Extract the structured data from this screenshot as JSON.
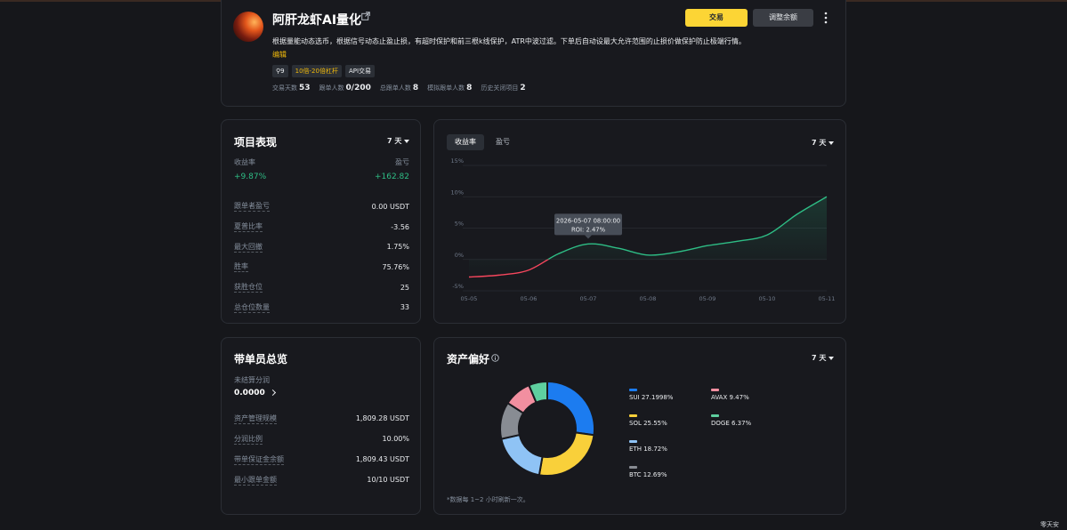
{
  "header": {
    "trader_name": "阿肝龙虾AI量化",
    "description": "根据量能动态选币，根据信号动态止盈止损，有超时保护和前三根k线保护，ATR中波过滤。下单后自动设最大允许范围的止损价做保护防止极端行情。",
    "edit_label": "编辑",
    "tags": [
      "9",
      "10倍-20倍杠杆",
      "API交易"
    ],
    "stats": [
      {
        "label": "交易天数",
        "value": "53"
      },
      {
        "label": "跟单人数",
        "value": "0/200"
      },
      {
        "label": "总跟单人数",
        "value": "8"
      },
      {
        "label": "模拟跟单人数",
        "value": "8"
      },
      {
        "label": "历史关闭项目",
        "value": "2"
      }
    ],
    "trade_button": "交易",
    "adjust_button": "调整余额"
  },
  "performance": {
    "title": "项目表现",
    "period": "7 天",
    "roi_label": "收益率",
    "pnl_label": "盈亏",
    "roi_value": "+9.87%",
    "pnl_value": "+162.82",
    "metrics": [
      {
        "label": "跟单者盈亏",
        "value": "0.00 USDT"
      },
      {
        "label": "夏普比率",
        "value": "-3.56"
      },
      {
        "label": "最大回撤",
        "value": "1.75%"
      },
      {
        "label": "胜率",
        "value": "75.76%"
      },
      {
        "label": "获胜仓位",
        "value": "25"
      },
      {
        "label": "总仓位数量",
        "value": "33"
      }
    ]
  },
  "roi_chart": {
    "tabs": [
      "收益率",
      "盈亏"
    ],
    "period": "7 天",
    "tooltip_time": "2026-05-07 08:00:00",
    "tooltip_roi": "ROI: 2.47%"
  },
  "lead_summary": {
    "title": "带单员总览",
    "unsettled_label": "未结算分润",
    "unsettled_value": "0.0000",
    "rows": [
      {
        "label": "资产管理规模",
        "value": "1,809.28 USDT"
      },
      {
        "label": "分润比例",
        "value": "10.00%"
      },
      {
        "label": "带单保证金余额",
        "value": "1,809.43 USDT"
      },
      {
        "label": "最小跟单金额",
        "value": "10/10 USDT"
      }
    ]
  },
  "asset_pref": {
    "title": "资产偏好",
    "period": "7 天",
    "footnote": "*数据每 1~2 小时刷新一次。"
  },
  "watermark": "零天安",
  "colors": {
    "up": "#2ebd85",
    "down": "#f6465d",
    "accent": "#fcd535"
  },
  "chart_data": [
    {
      "type": "line",
      "ylim": [
        -5,
        15
      ],
      "y_ticks": [
        "15%",
        "10%",
        "5%",
        "0%",
        "-5%"
      ],
      "x_ticks": [
        "05-05",
        "05-06",
        "05-07",
        "05-08",
        "05-09",
        "05-10",
        "05-11"
      ],
      "x": [
        "05-05",
        "05-05 12:00",
        "05-06",
        "05-06 12:00",
        "05-07",
        "05-07 12:00",
        "05-08",
        "05-08 12:00",
        "05-09",
        "05-09 12:00",
        "05-10",
        "05-10 12:00",
        "05-11"
      ],
      "y": [
        -2.8,
        -2.5,
        -1.7,
        0.9,
        2.47,
        1.8,
        0.7,
        1.2,
        2.2,
        2.9,
        3.9,
        7.2,
        10.0
      ],
      "xlabel": "",
      "ylabel": ""
    },
    {
      "type": "pie",
      "labels": [
        "SUI",
        "SOL",
        "ETH",
        "BTC",
        "AVAX",
        "DOGE"
      ],
      "values": [
        27.1998,
        25.55,
        18.72,
        12.69,
        9.47,
        6.37
      ],
      "value_labels": [
        "27.1998%",
        "25.55%",
        "18.72%",
        "12.69%",
        "9.47%",
        "6.37%"
      ],
      "colors": [
        "#1c7cf0",
        "#f9d03a",
        "#8fc3f5",
        "#888c93",
        "#f28fa0",
        "#5ecf9f"
      ]
    }
  ]
}
